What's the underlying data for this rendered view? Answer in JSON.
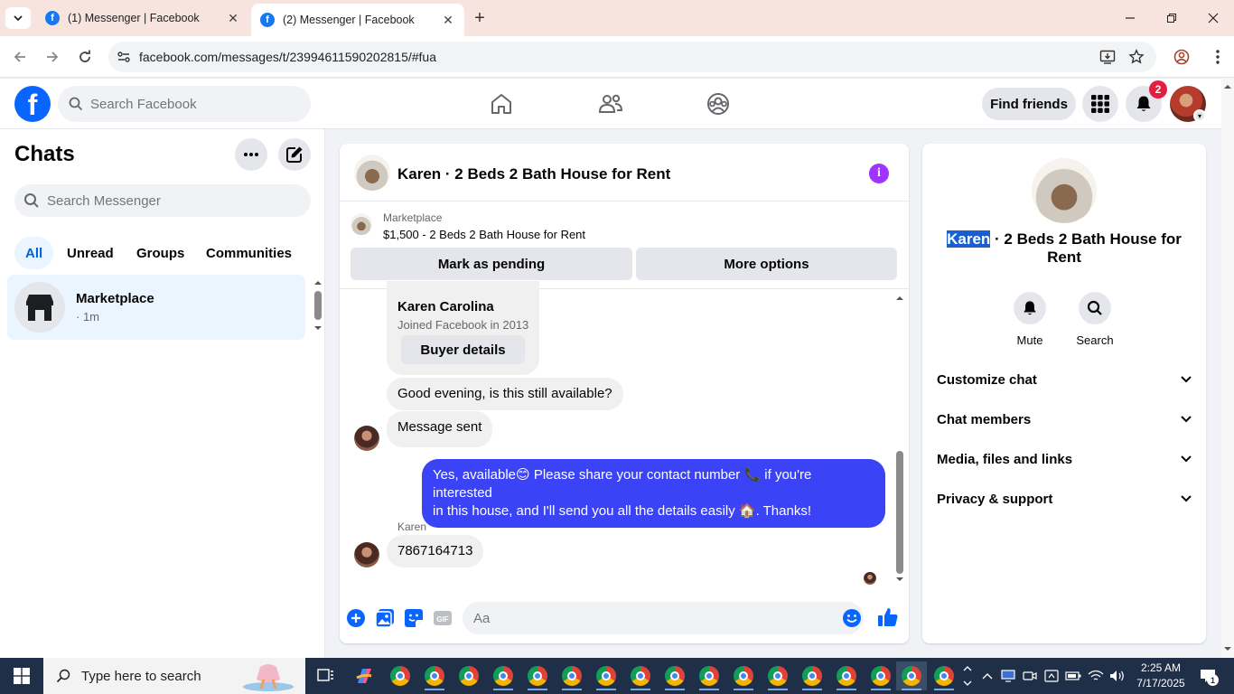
{
  "browser": {
    "tabs": [
      {
        "title": "(1) Messenger | Facebook",
        "active": false
      },
      {
        "title": "(2) Messenger | Facebook",
        "active": true
      }
    ],
    "url": "facebook.com/messages/t/23994611590202815/#fua"
  },
  "fb_header": {
    "logo": "f",
    "search_placeholder": "Search Facebook",
    "find_friends": "Find friends",
    "notification_count": "2"
  },
  "sidebar": {
    "title": "Chats",
    "search_placeholder": "Search Messenger",
    "filters": [
      "All",
      "Unread",
      "Groups",
      "Communities"
    ],
    "active_filter": "All",
    "chats": [
      {
        "name": "Marketplace",
        "subtitle": "· 1m"
      }
    ]
  },
  "conversation": {
    "title": "Karen · 2 Beds 2 Bath House for Rent",
    "marketplace_label": "Marketplace",
    "listing": "$1,500 - 2 Beds 2 Bath House for Rent",
    "mark_pending": "Mark as pending",
    "more_options": "More options",
    "profile_card": {
      "name": "Karen Carolina",
      "joined": "Joined Facebook in 2013",
      "button": "Buyer details"
    },
    "messages": [
      {
        "direction": "in",
        "text": "Good evening, is this still available?"
      },
      {
        "direction": "in",
        "text": "Message sent"
      },
      {
        "direction": "out",
        "line1": "Yes, available😊 Please share your contact number 📞 if you're interested",
        "line2": "in this house, and I'll send you all the details easily 🏠. Thanks!"
      },
      {
        "direction": "in",
        "sender": "Karen",
        "text": "7867164713"
      }
    ],
    "composer_placeholder": "Aa"
  },
  "info_panel": {
    "title_highlight": "Karen",
    "title_rest": " · 2 Beds 2 Bath House for Rent",
    "actions": [
      {
        "label": "Mute",
        "icon": "bell-icon"
      },
      {
        "label": "Search",
        "icon": "search-icon"
      }
    ],
    "sections": [
      "Customize chat",
      "Chat members",
      "Media, files and links",
      "Privacy & support"
    ]
  },
  "taskbar": {
    "search_placeholder": "Type here to search",
    "time": "2:25 AM",
    "date": "7/17/2025",
    "notification_count": "1"
  }
}
